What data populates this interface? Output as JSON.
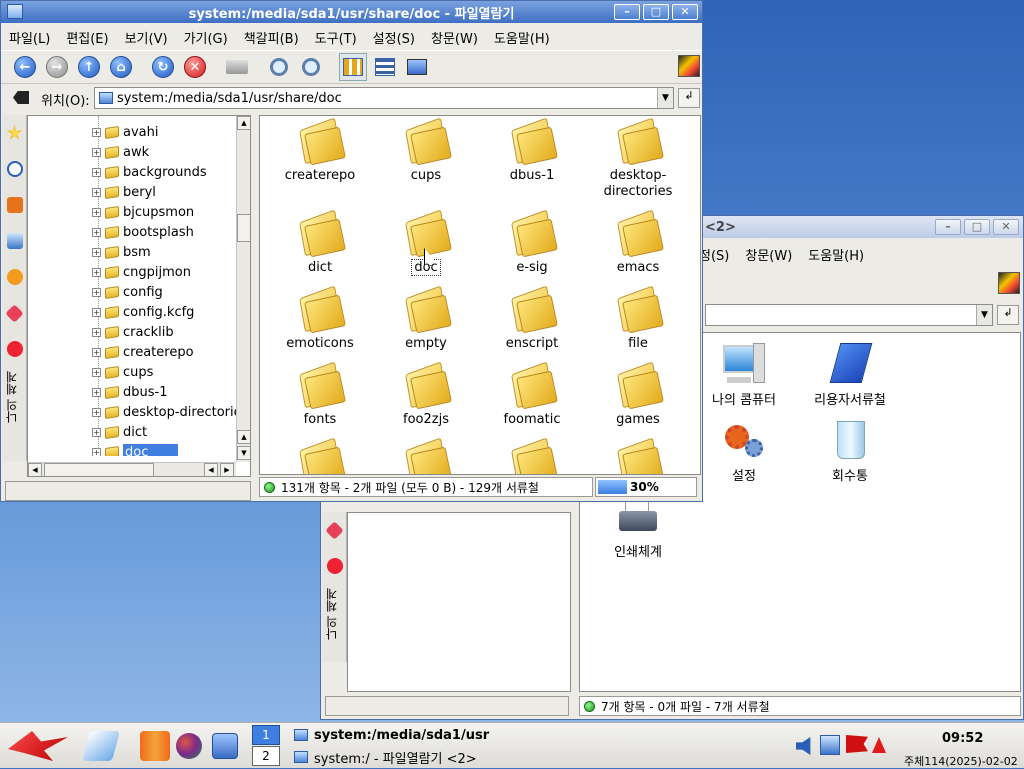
{
  "main_window": {
    "title": "system:/media/sda1/usr/share/doc - 파일열람기",
    "menus": [
      "파일(L)",
      "편집(E)",
      "보기(V)",
      "가기(G)",
      "책갈피(B)",
      "도구(T)",
      "설정(S)",
      "창문(W)",
      "도움말(H)"
    ],
    "location_label": "위치(O):",
    "location_value": "system:/media/sda1/usr/share/doc",
    "sidebar_label": "나의 체계",
    "tree_items": [
      "avahi",
      "awk",
      "backgrounds",
      "beryl",
      "bjcupsmon",
      "bootsplash",
      "bsm",
      "cngpijmon",
      "config",
      "config.kcfg",
      "cracklib",
      "createrepo",
      "cups",
      "dbus-1",
      "desktop-directorie",
      "dict",
      "doc"
    ],
    "selected_tree_item": "doc",
    "icons": [
      "createrepo",
      "cups",
      "dbus-1",
      "desktop-\ndirectories",
      "dict",
      "doc",
      "e-sig",
      "emacs",
      "emoticons",
      "empty",
      "enscript",
      "file",
      "fonts",
      "foo2zjs",
      "foomatic",
      "games"
    ],
    "status_text": "131개 항목 - 2개 파일 (모두 0 B) - 129개 서류철",
    "progress_label": "30%",
    "progress_value": 30
  },
  "second_window": {
    "title_suffix": "<2>",
    "menus": [
      "정(S)",
      "창문(W)",
      "도움말(H)"
    ],
    "sidebar_label": "나의 체계",
    "icons": [
      "나의 콤퓨터",
      "리용자서류철",
      "설정",
      "회수통",
      "인쇄체계"
    ],
    "status_text": "7개 항목 - 0개 파일 - 7개 서류철"
  },
  "taskbar": {
    "pager": [
      "1",
      "2"
    ],
    "tasks": [
      "system:/media/sda1/usr",
      "system:/ - 파일열람기 <2>"
    ],
    "clock": "09:52",
    "date": "주체114(2025)-02-02"
  },
  "colors": {
    "title_active": "#3f6fc2",
    "selection": "#3f7fe0",
    "desktop": "#3f74c4"
  }
}
